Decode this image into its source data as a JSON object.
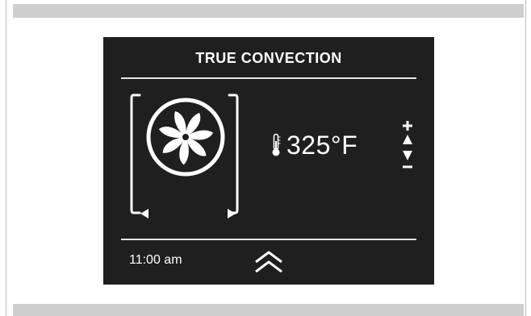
{
  "screen": {
    "mode_title": "TRUE CONVECTION",
    "temperature": "325°F",
    "time": "11:00 am"
  },
  "icons": {
    "fan": "fan-icon",
    "thermometer": "thermometer-icon",
    "previous": "arrow-left-icon",
    "next": "arrow-right-icon",
    "increase": "plus-icon",
    "up": "arrow-up-icon",
    "down": "arrow-down-icon",
    "decrease": "minus-icon",
    "expand": "chevron-up-icon"
  },
  "colors": {
    "screen_bg": "#1f1f1f",
    "foreground": "#ffffff",
    "frame_bar": "#cfcfcf"
  }
}
